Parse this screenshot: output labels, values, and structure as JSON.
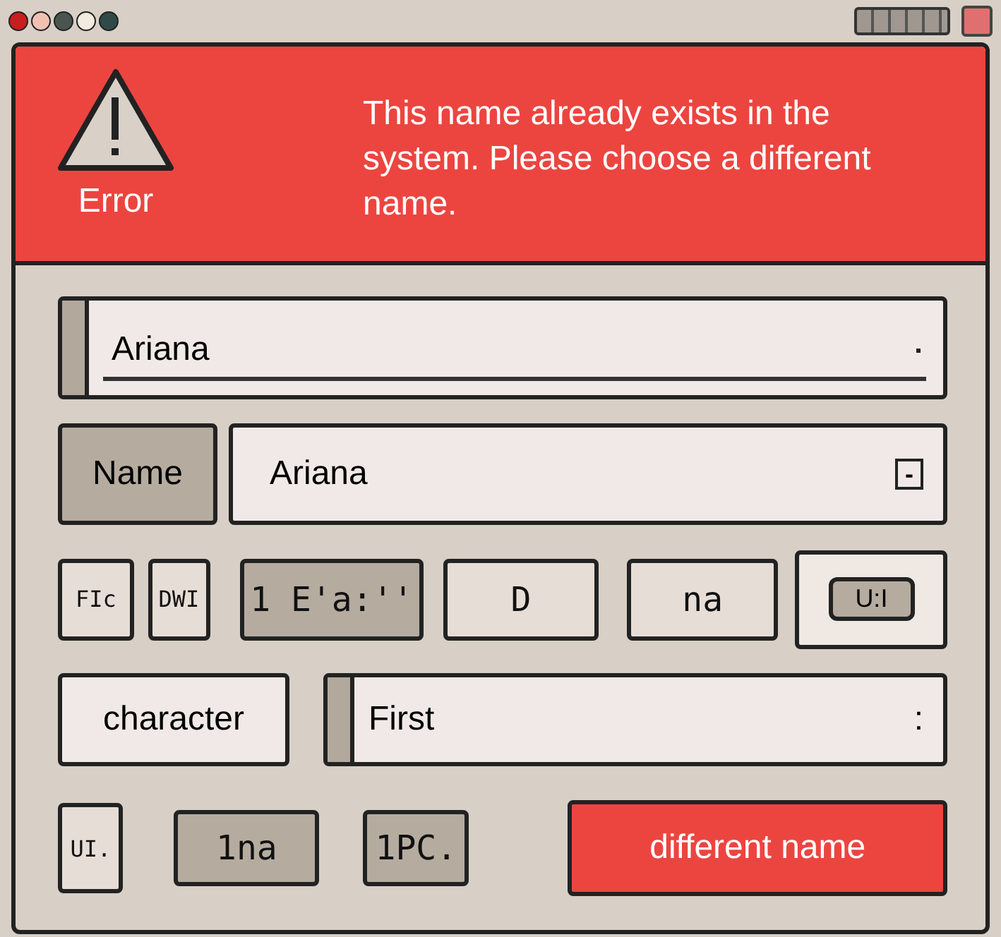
{
  "title_bar": {
    "dots": [
      {
        "color": "#c81e1e"
      },
      {
        "color": "#f0c0b0"
      },
      {
        "color": "#4a5550"
      },
      {
        "color": "#f2ece0"
      },
      {
        "color": "#2f4a48"
      }
    ]
  },
  "error": {
    "label": "Error",
    "message": "This name already exists in the system. Please choose a different name."
  },
  "top_field": {
    "value": "Ariana"
  },
  "name_row": {
    "label": "Name",
    "value": "Ariana",
    "button": "-"
  },
  "buttons": [
    {
      "label": "FIc",
      "kind": "light"
    },
    {
      "label": "DWI",
      "kind": "light"
    },
    {
      "label": "1 E'a:''",
      "kind": "dark"
    },
    {
      "label": "D",
      "kind": "light"
    },
    {
      "label": "na",
      "kind": "light"
    },
    {
      "label": "U:I",
      "kind": "pill"
    }
  ],
  "character_row": {
    "label": "character",
    "value": "First",
    "suffix": ":"
  },
  "bottom_buttons": [
    {
      "label": "UI.",
      "kind": "tab"
    },
    {
      "label": "1na",
      "kind": "dark"
    },
    {
      "label": "1PC.",
      "kind": "dark"
    },
    {
      "label": "different name",
      "kind": "primary"
    }
  ]
}
